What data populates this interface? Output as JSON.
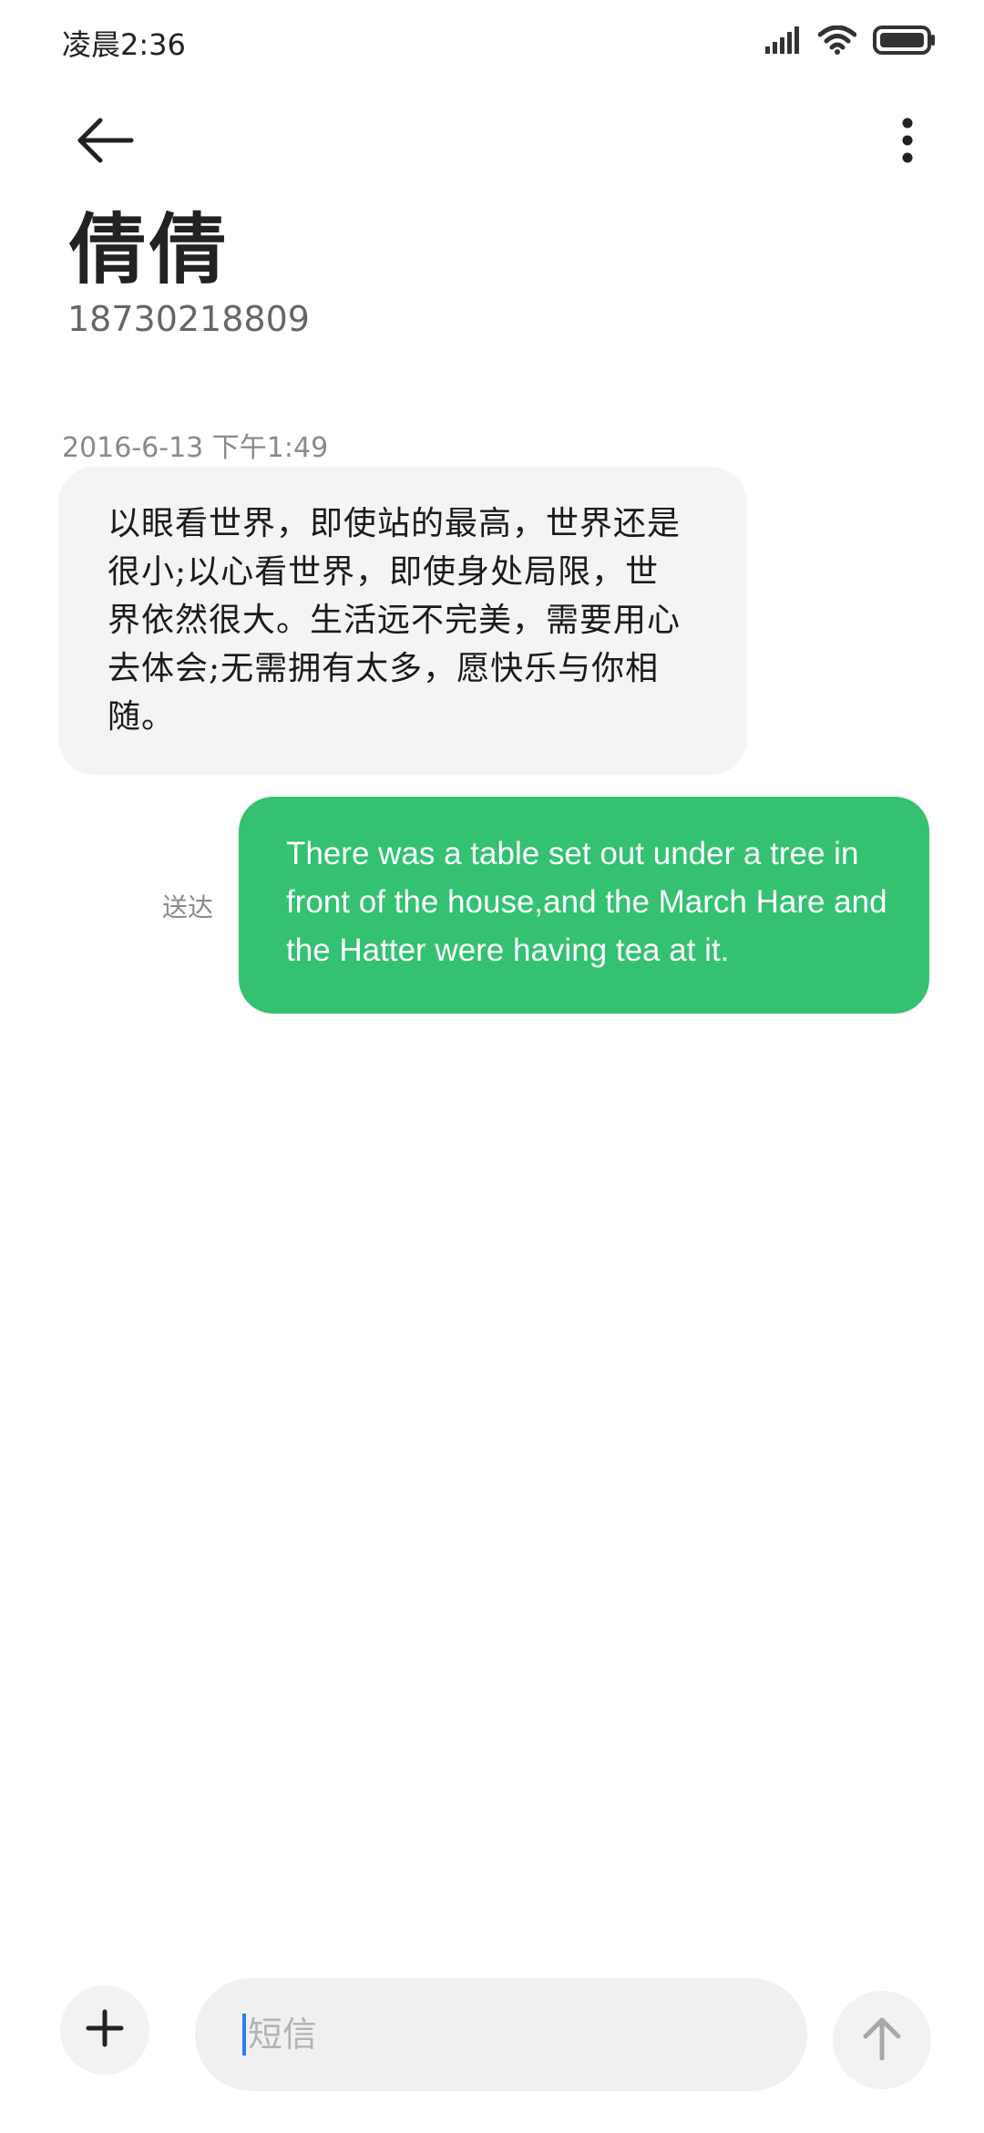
{
  "status_bar": {
    "time": "凌晨2:36",
    "icons": [
      "signal-icon",
      "wifi-icon",
      "battery-icon"
    ]
  },
  "header": {
    "back_icon": "arrow-left-icon",
    "more_icon": "more-vertical-icon",
    "contact_name": "倩倩",
    "contact_number": "18730218809"
  },
  "conversation": {
    "timestamp": "2016-6-13 下午1:49",
    "incoming": {
      "text": "以眼看世界，即使站的最高，世界还是很小;以心看世界，即使身处局限，世界依然很大。生活远不完美，需要用心去体会;无需拥有太多，愿快乐与你相随。"
    },
    "outgoing": {
      "text": "There was a table set out under a tree in front of the house,and the March Hare and the Hatter were having tea at it.",
      "status": "送达"
    }
  },
  "composer": {
    "attach_icon": "plus-icon",
    "placeholder": "短信",
    "value": "",
    "send_icon": "arrow-up-icon"
  },
  "colors": {
    "outgoing_bubble": "#34c172",
    "incoming_bubble": "#f4f4f4",
    "cursor": "#2f7cf6"
  }
}
